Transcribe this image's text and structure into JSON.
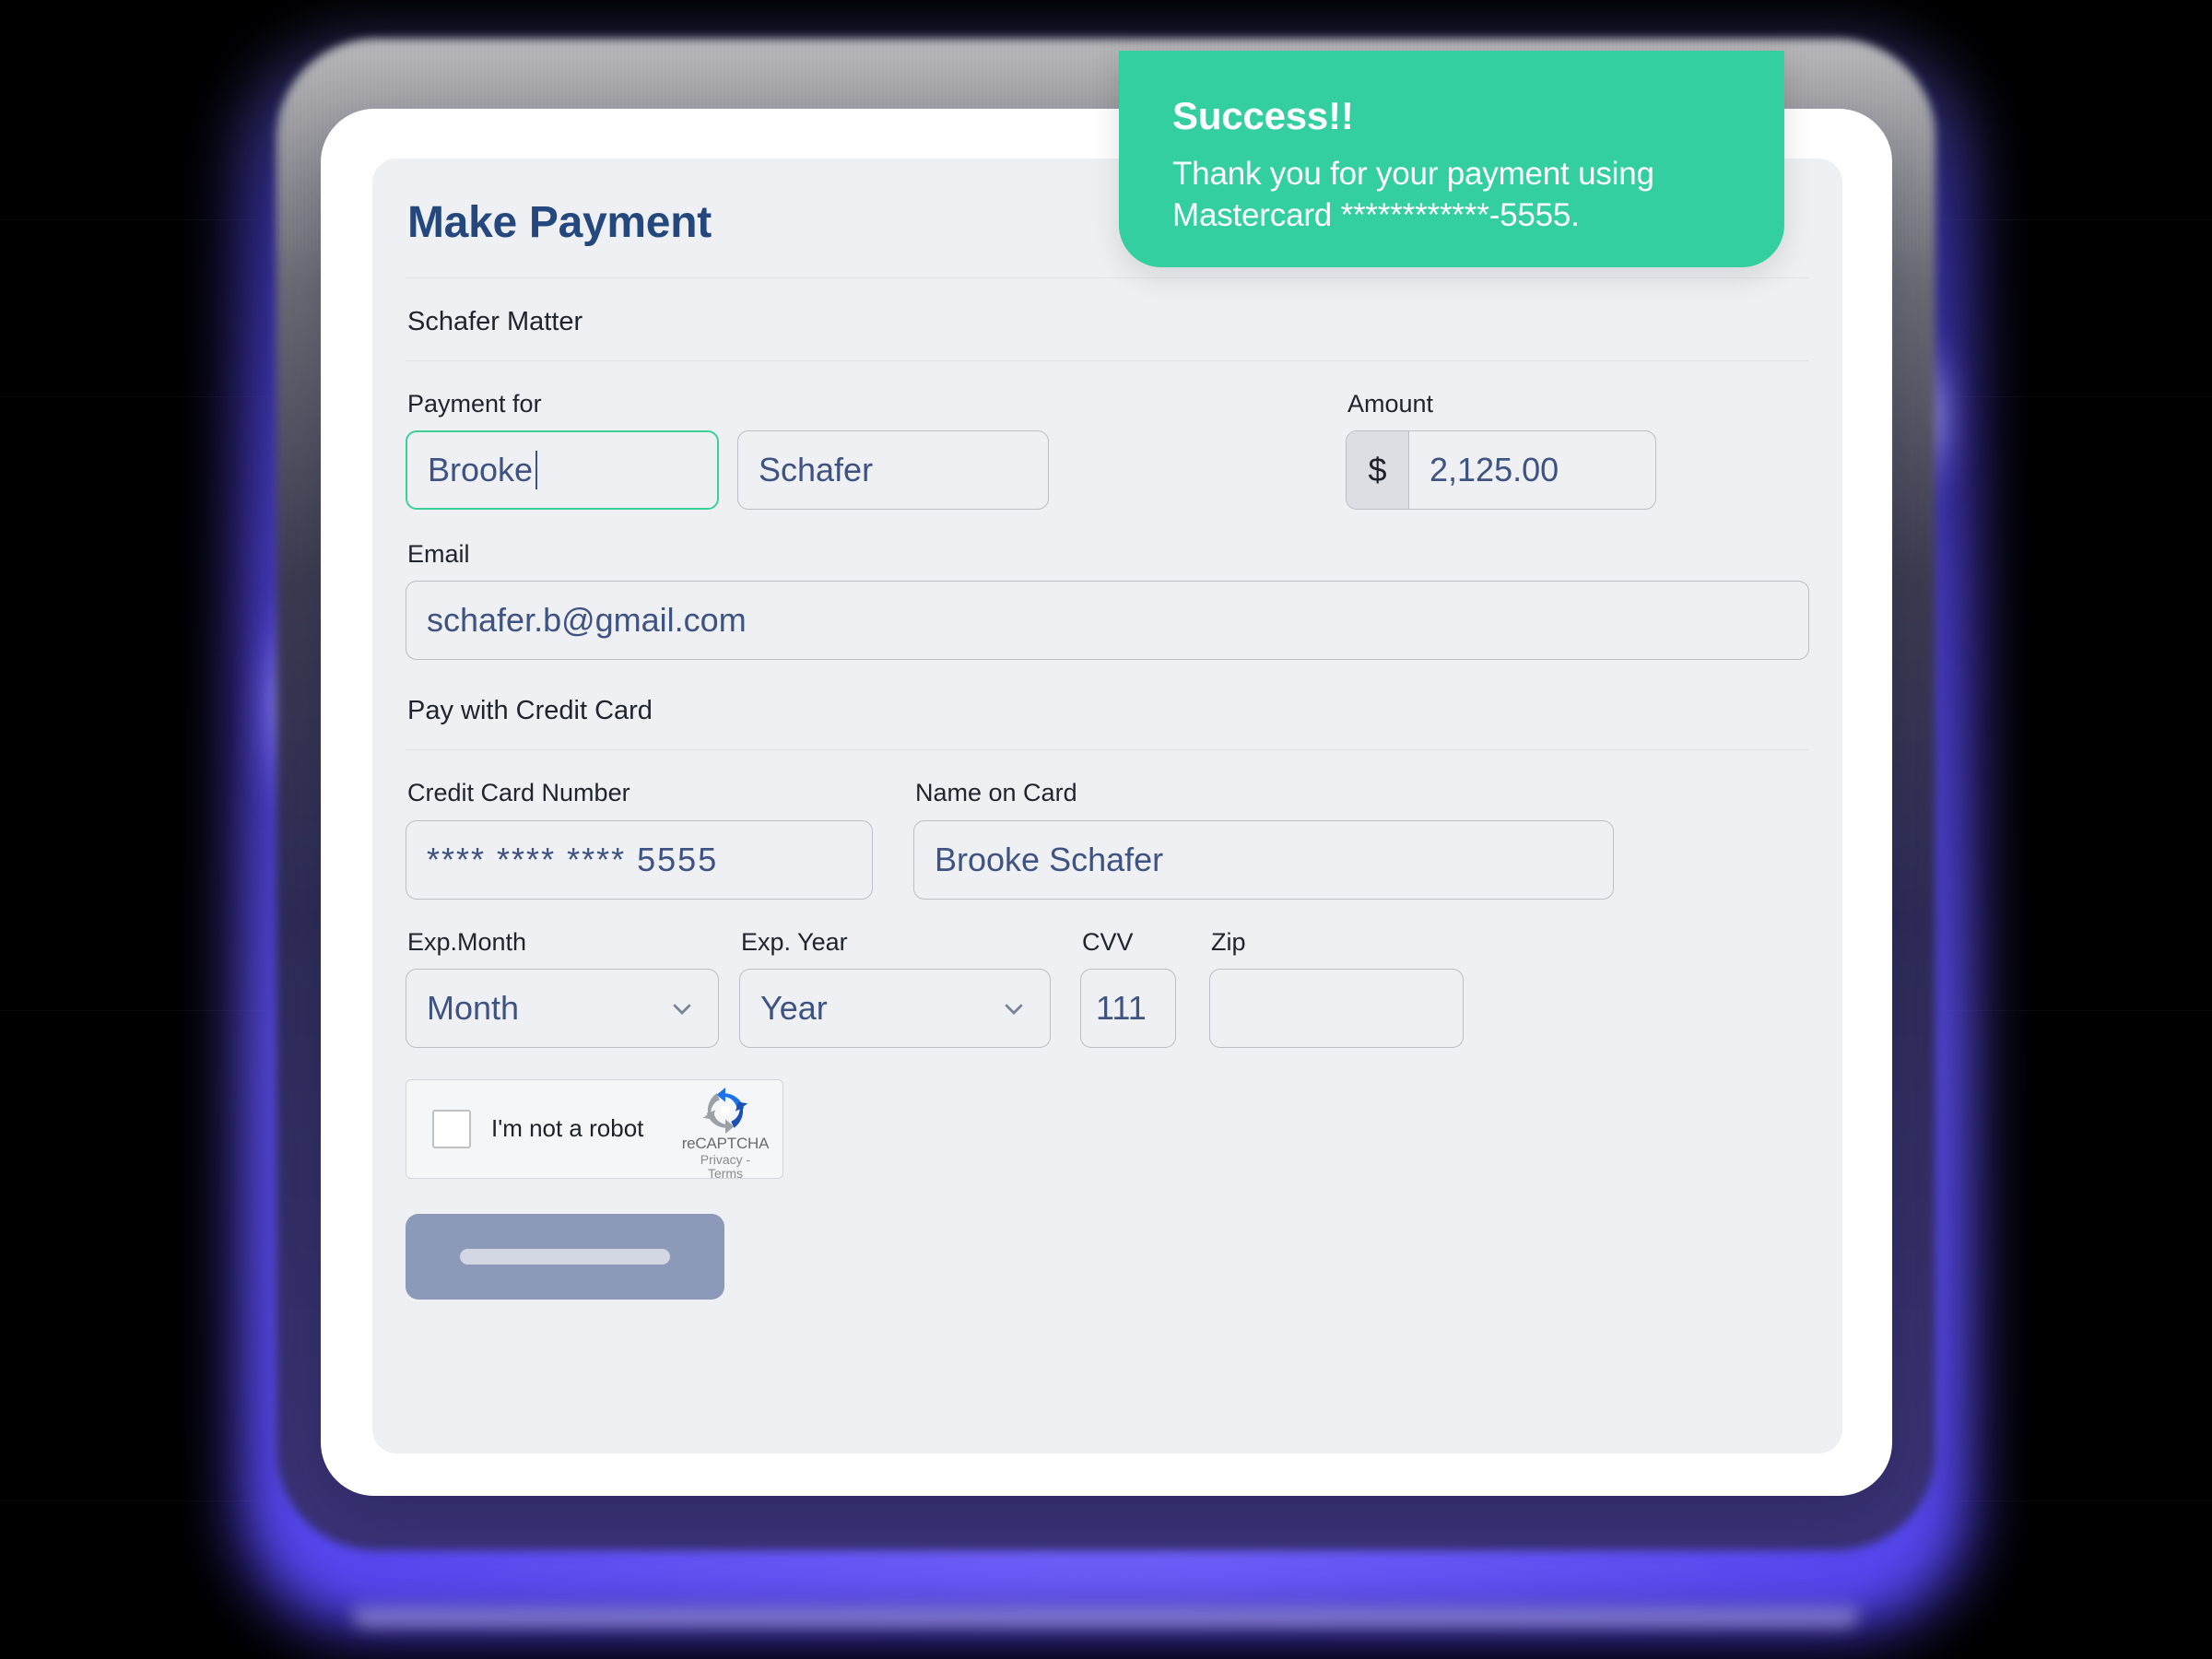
{
  "toast": {
    "title": "Success!!",
    "message_line1": "Thank you for your payment using",
    "message_line2": "Mastercard ************-5555."
  },
  "form": {
    "title": "Make Payment",
    "matter": "Schafer Matter",
    "payment_for": {
      "label": "Payment for",
      "first_name_value": "Brooke",
      "last_name_value": "Schafer"
    },
    "amount": {
      "label": "Amount",
      "currency_symbol": "$",
      "value": "2,125.00"
    },
    "email": {
      "label": "Email",
      "value": "schafer.b@gmail.com"
    },
    "credit_card_section_label": "Pay with Credit Card",
    "credit_card_number": {
      "label": "Credit Card Number",
      "value": "**** **** **** 5555"
    },
    "name_on_card": {
      "label": "Name on Card",
      "value": "Brooke Schafer"
    },
    "exp_month": {
      "label": "Exp.Month",
      "value": "Month"
    },
    "exp_year": {
      "label": "Exp. Year",
      "value": "Year"
    },
    "cvv": {
      "label": "CVV",
      "value": "111"
    },
    "zip": {
      "label": "Zip",
      "value": ""
    }
  },
  "recaptcha": {
    "checkbox_label": "I'm not a robot",
    "brand_name": "reCAPTCHA",
    "terms": "Privacy - Terms"
  },
  "submit": {
    "label": ""
  },
  "colors": {
    "toast_green": "#34cfa0",
    "focus_green": "#3ccf9a",
    "title_blue": "#24487e",
    "input_text_blue": "#3f5382",
    "card_bg": "#eef0f4",
    "glow_purple": "#6254f5",
    "submit_button": "#8d99b9"
  }
}
